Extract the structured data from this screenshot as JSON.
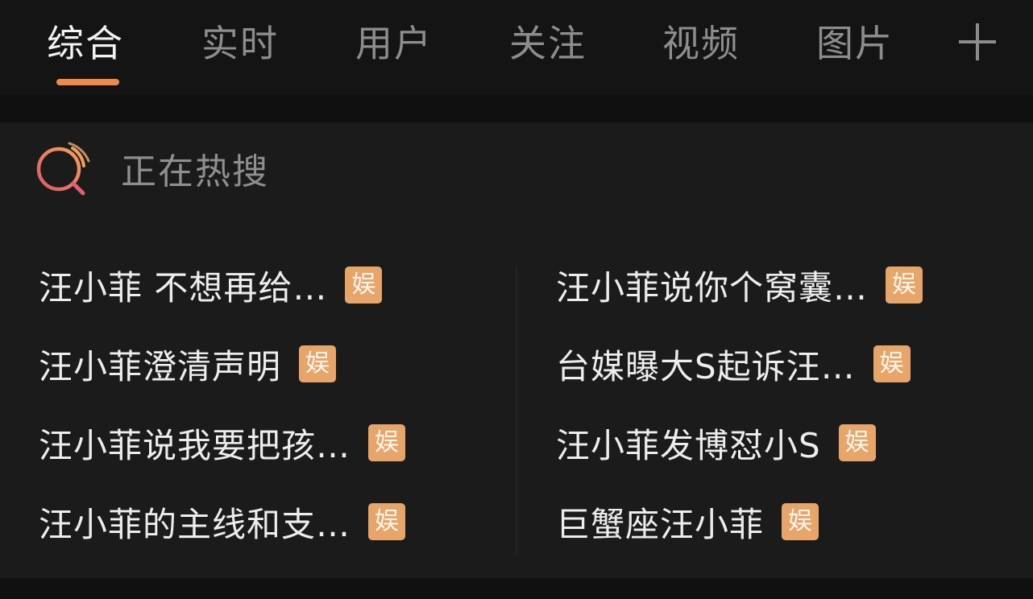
{
  "tabs": [
    {
      "label": "综合",
      "active": true
    },
    {
      "label": "实时",
      "active": false
    },
    {
      "label": "用户",
      "active": false
    },
    {
      "label": "关注",
      "active": false
    },
    {
      "label": "视频",
      "active": false
    },
    {
      "label": "图片",
      "active": false
    }
  ],
  "add_tab_icon": "plus-icon",
  "hot_section": {
    "icon": "hot-search-icon",
    "title": "正在热搜"
  },
  "left_items": [
    {
      "text": "汪小菲 不想再给…",
      "badge": "娱"
    },
    {
      "text": "汪小菲澄清声明",
      "badge": "娱"
    },
    {
      "text": "汪小菲说我要把孩…",
      "badge": "娱"
    },
    {
      "text": "汪小菲的主线和支…",
      "badge": "娱"
    }
  ],
  "right_items": [
    {
      "text": "汪小菲说你个窝囊…",
      "badge": "娱"
    },
    {
      "text": "台媒曝大S起诉汪…",
      "badge": "娱"
    },
    {
      "text": "汪小菲发博怼小S",
      "badge": "娱"
    },
    {
      "text": "巨蟹座汪小菲",
      "badge": "娱"
    }
  ],
  "colors": {
    "accent": "#f08a4b",
    "badge": "#e7a56a",
    "background": "#161617"
  }
}
